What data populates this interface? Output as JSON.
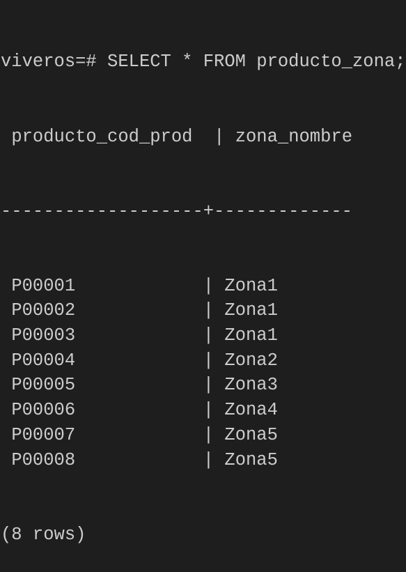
{
  "terminal": {
    "prompt": "viveros=# ",
    "command": "SELECT * FROM producto_zona;",
    "columns": [
      "producto_cod_prod",
      "zona_nombre"
    ],
    "separator": "-------------------+-------------",
    "rows": [
      [
        "P00001",
        "Zona1"
      ],
      [
        "P00002",
        "Zona1"
      ],
      [
        "P00003",
        "Zona1"
      ],
      [
        "P00004",
        "Zona2"
      ],
      [
        "P00005",
        "Zona3"
      ],
      [
        "P00006",
        "Zona4"
      ],
      [
        "P00007",
        "Zona5"
      ],
      [
        "P00008",
        "Zona5"
      ]
    ],
    "footer": "(8 rows)",
    "colors": {
      "background": "#1e1e1e",
      "text": "#cccccc"
    }
  }
}
